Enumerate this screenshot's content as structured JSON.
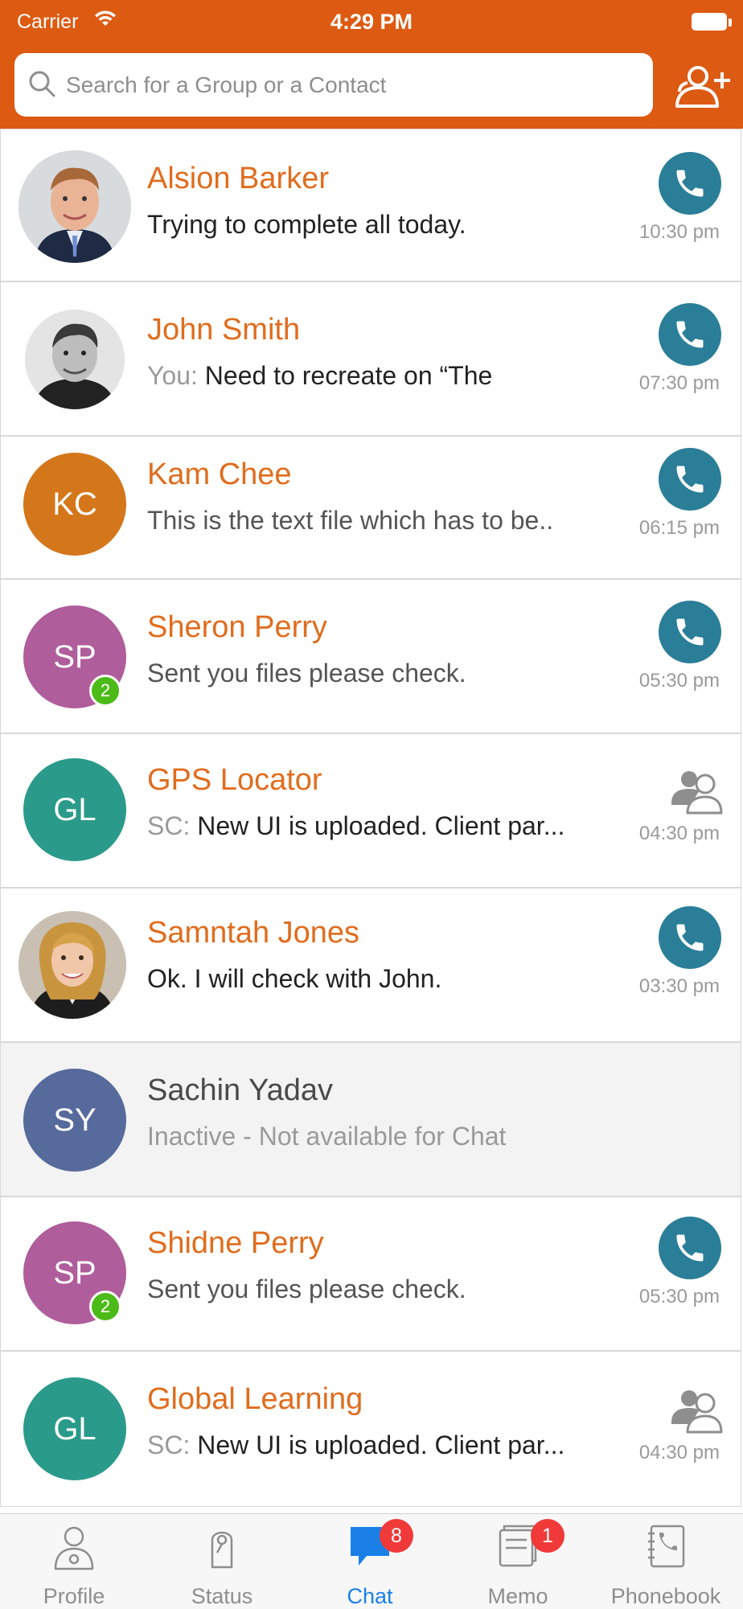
{
  "status_bar": {
    "carrier": "Carrier",
    "time": "4:29 PM"
  },
  "search": {
    "placeholder": "Search for a Group or a Contact",
    "value": ""
  },
  "colors": {
    "brand": "#dd5a12",
    "name_orange": "#e06d1e",
    "call_teal": "#2a7e98",
    "active_tab": "#1a7fe6",
    "badge_green": "#4cbb17",
    "badge_red": "#f03a3a"
  },
  "chats": [
    {
      "name": "Alsion Barker",
      "prefix": "",
      "message": "Trying to complete all today.",
      "time": "10:30 pm",
      "initials": "",
      "avatar": "photo",
      "action": "call-icon"
    },
    {
      "name": "John Smith",
      "prefix": "You:",
      "message": "Need to recreate on “The",
      "time": "07:30 pm",
      "initials": "",
      "avatar": "photo",
      "action": "call-icon"
    },
    {
      "name": "Kam Chee",
      "prefix": "",
      "message": "This is the text file which has to be..",
      "time": "06:15 pm",
      "initials": "KC",
      "avatar_color": "#d4761a",
      "action": "call-icon"
    },
    {
      "name": "Sheron Perry",
      "prefix": "",
      "message": "Sent you files please check.",
      "time": "05:30 pm",
      "initials": "SP",
      "avatar_color": "#b05d9c",
      "unread": "2",
      "action": "call-icon"
    },
    {
      "name": "GPS Locator",
      "prefix": "SC:",
      "message": "New UI is uploaded. Client par...",
      "time": "04:30 pm",
      "initials": "GL",
      "avatar_color": "#2a9a8a",
      "action": "group-icon"
    },
    {
      "name": "Samntah Jones",
      "prefix": "",
      "message": "Ok. I will check with John.",
      "time": "03:30 pm",
      "initials": "",
      "avatar": "photo",
      "action": "call-icon"
    },
    {
      "name": "Sachin Yadav",
      "prefix": "",
      "message": "Inactive - Not available for Chat",
      "time": "",
      "initials": "SY",
      "avatar_color": "#566a9c",
      "inactive": true
    },
    {
      "name": "Shidne Perry",
      "prefix": "",
      "message": "Sent you files please check.",
      "time": "05:30 pm",
      "initials": "SP",
      "avatar_color": "#b05d9c",
      "unread": "2",
      "action": "call-icon"
    },
    {
      "name": "Global Learning",
      "prefix": "SC:",
      "message": "New UI is uploaded. Client par...",
      "time": "04:30 pm",
      "initials": "GL",
      "avatar_color": "#2a9a8a",
      "action": "group-icon"
    }
  ],
  "tabs": [
    {
      "label": "Profile",
      "icon": "profile-icon"
    },
    {
      "label": "Status",
      "icon": "status-icon"
    },
    {
      "label": "Chat",
      "icon": "chat-icon",
      "badge": "8",
      "active": true
    },
    {
      "label": "Memo",
      "icon": "memo-icon",
      "badge": "1"
    },
    {
      "label": "Phonebook",
      "icon": "phonebook-icon"
    }
  ]
}
